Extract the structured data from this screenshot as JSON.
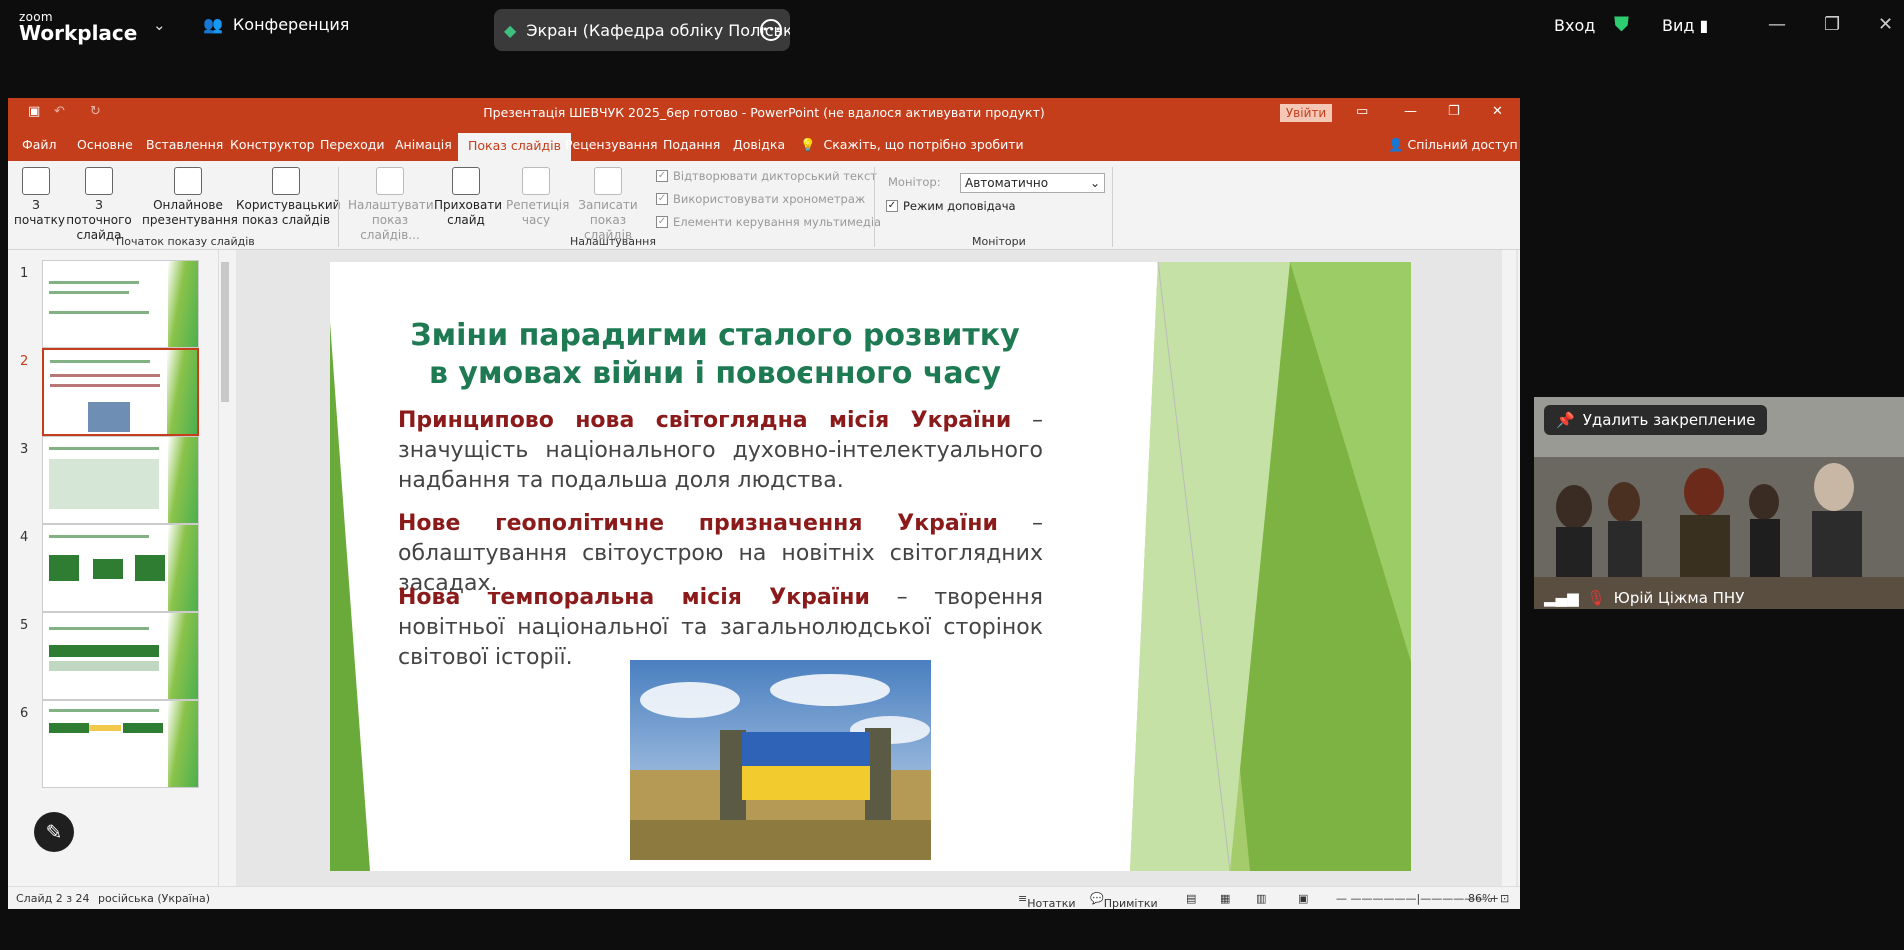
{
  "zoom": {
    "logo_small": "zoom",
    "logo_big": "Workplace",
    "conference": "Конференция",
    "share_title": "Экран (Кафедра обліку Поліськ",
    "login": "Вход",
    "view": "Вид"
  },
  "ppt": {
    "title": "Презентація ШЕВЧУК 2025_6ер готово  -  PowerPoint (не вдалося активувати продукт)",
    "login": "Увійти",
    "menu": [
      "Файл",
      "Основне",
      "Вставлення",
      "Конструктор",
      "Переходи",
      "Анімація",
      "Показ слайдів",
      "Рецензування",
      "Подання",
      "Довідка"
    ],
    "tell": "Скажіть, що потрібно зробити",
    "share": "Спільний доступ",
    "ribbon": {
      "from_start": "З початку",
      "from_current": "З поточного слайда",
      "online": "Онлайнове презентування",
      "custom": "Користувацький показ слайдів",
      "group1": "Початок показу слайдів",
      "setup": "Налаштувати показ слайдів...",
      "hide": "Приховати слайд",
      "rehearse": "Репетиція часу",
      "record": "Записати показ слайдів",
      "group2": "Налаштування",
      "chk1": "Відтворювати дикторський текст",
      "chk2": "Використовувати хронометраж",
      "chk3": "Елементи керування мультимедіа",
      "monitor_label": "Монітор:",
      "monitor_value": "Автоматично",
      "presenter": "Режим доповідача",
      "group3": "Монітори"
    },
    "slide_numbers": [
      "1",
      "2",
      "3",
      "4",
      "5",
      "6"
    ],
    "slide": {
      "title": "Зміни парадигми сталого розвитку в умовах війни і повоєнного часу",
      "p1_bold": "Принципово нова світоглядна місія України",
      "p1_rest": " – значущість національного духовно-інтелектуального надбання та подальша доля людства.",
      "p2_bold": "Нове геополітичне призначення України",
      "p2_rest": " – облаштування світоустрою на новітніх світоглядних засадах.",
      "p3_bold": "Нова темпоральна місія України",
      "p3_rest": " – творення новітньої національної та загальнолюдської сторінок світової історії."
    },
    "status": {
      "slide": "Слайд 2 з 24",
      "lang": "російська (Україна)",
      "notes": "Нотатки",
      "comments": "Примітки",
      "zoom": "86%"
    }
  },
  "video": {
    "unpin": "Удалить закрепление",
    "name": "Юрій Ціжма ПНУ"
  }
}
